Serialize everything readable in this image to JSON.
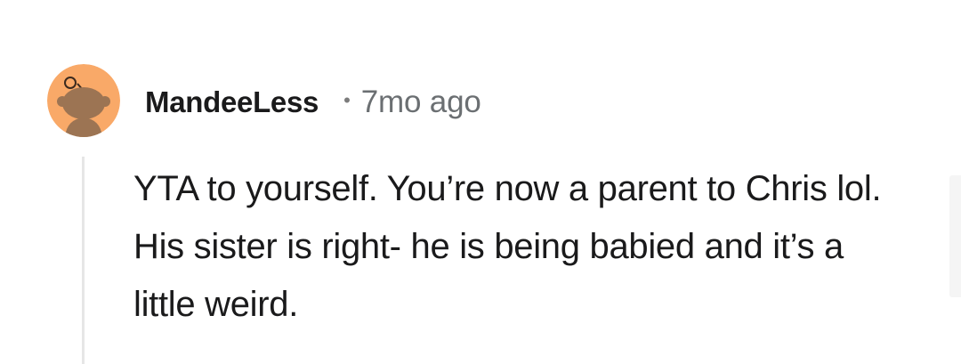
{
  "comment": {
    "avatar_icon": "snoo-avatar-icon",
    "avatar_bg": "#f9a968",
    "username": "MandeeLess",
    "separator": "•",
    "timestamp": "7mo ago",
    "body": "YTA to yourself. You’re now a parent to Chris lol. His sister is right- he is being babied and it’s a little weird."
  }
}
